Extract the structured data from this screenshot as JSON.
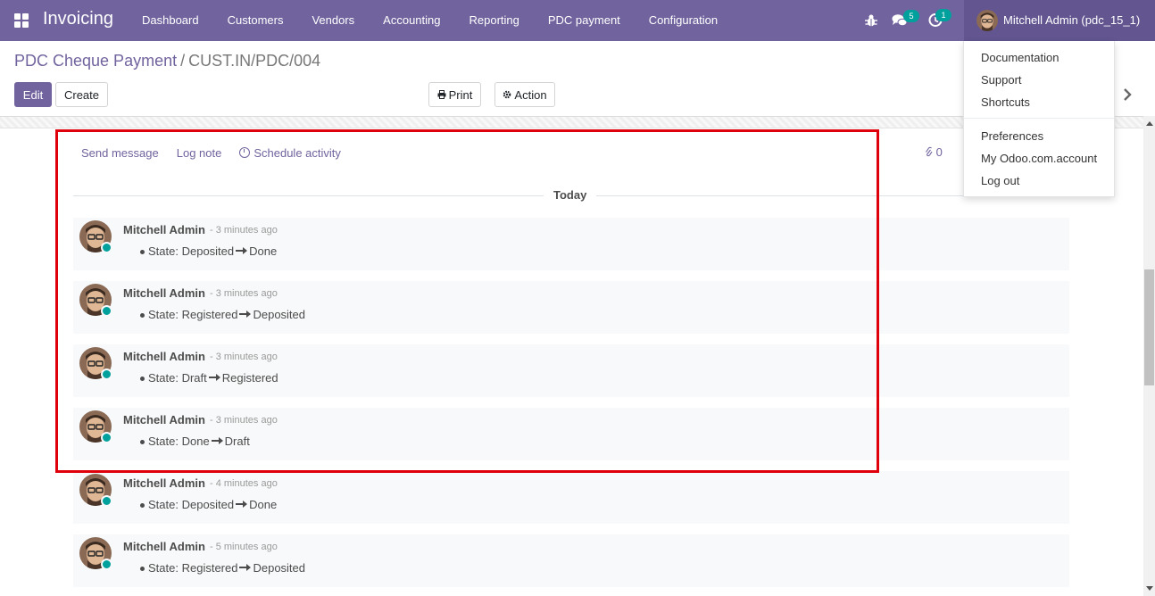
{
  "navbar": {
    "app_name": "Invoicing",
    "menu": [
      "Dashboard",
      "Customers",
      "Vendors",
      "Accounting",
      "Reporting",
      "PDC payment",
      "Configuration"
    ],
    "chat_badge": "5",
    "activity_badge": "1",
    "user_name": "Mitchell Admin (pdc_15_1)"
  },
  "breadcrumb": {
    "parent": "PDC Cheque Payment",
    "separator": "/",
    "current": "CUST.IN/PDC/004"
  },
  "buttons": {
    "edit": "Edit",
    "create": "Create",
    "print": "Print",
    "action": "Action"
  },
  "chatter": {
    "send_message": "Send message",
    "log_note": "Log note",
    "schedule_activity": "Schedule activity",
    "attachments_count": "0",
    "date_separator": "Today",
    "messages": [
      {
        "author": "Mitchell Admin",
        "date": "- 3 minutes ago",
        "field": "State:",
        "old": "Deposited",
        "new": "Done"
      },
      {
        "author": "Mitchell Admin",
        "date": "- 3 minutes ago",
        "field": "State:",
        "old": "Registered",
        "new": "Deposited"
      },
      {
        "author": "Mitchell Admin",
        "date": "- 3 minutes ago",
        "field": "State:",
        "old": "Draft",
        "new": "Registered"
      },
      {
        "author": "Mitchell Admin",
        "date": "- 3 minutes ago",
        "field": "State:",
        "old": "Done",
        "new": "Draft"
      },
      {
        "author": "Mitchell Admin",
        "date": "- 4 minutes ago",
        "field": "State:",
        "old": "Deposited",
        "new": "Done"
      },
      {
        "author": "Mitchell Admin",
        "date": "- 5 minutes ago",
        "field": "State:",
        "old": "Registered",
        "new": "Deposited"
      }
    ]
  },
  "user_dropdown": [
    "Documentation",
    "Support",
    "Shortcuts",
    "Preferences",
    "My Odoo.com.account",
    "Log out"
  ],
  "colors": {
    "brand": "#71639e",
    "online": "#00a09d",
    "highlight": "#e0000b"
  }
}
